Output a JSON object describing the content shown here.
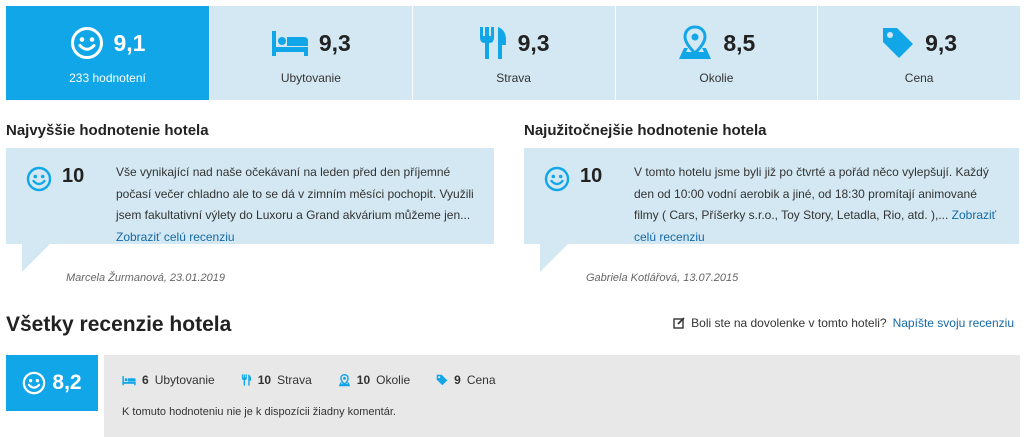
{
  "ratings": {
    "overall": {
      "score": "9,1",
      "label": "233 hodnotení",
      "icon": "smiley-icon"
    },
    "categories": [
      {
        "score": "9,3",
        "label": "Ubytovanie",
        "icon": "bed-icon"
      },
      {
        "score": "9,3",
        "label": "Strava",
        "icon": "fork-knife-icon"
      },
      {
        "score": "8,5",
        "label": "Okolie",
        "icon": "map-pin-icon"
      },
      {
        "score": "9,3",
        "label": "Cena",
        "icon": "price-tag-icon"
      }
    ]
  },
  "featured": {
    "best": {
      "title": "Najvyššie hodnotenie hotela",
      "score": "10",
      "text": "Vše vynikající nad naše očekávaní na leden před den příjemné počasí večer chladno ale to se dá v zimním měsíci pochopit. Využili jsem fakultativní výlety do Luxoru a Grand akvárium můžeme jen...",
      "more_link": "Zobraziť celú recenziu",
      "author": "Marcela Žurmanová, 23.01.2019"
    },
    "useful": {
      "title": "Najužitočnejšie hodnotenie hotela",
      "score": "10",
      "text": "V tomto hotelu jsme byli již po čtvrté a pořád něco vylepšují. Každý den od 10:00 vodní aerobik a jiné, od 18:30 promítají animované filmy ( Cars, Příšerky s.r.o., Toy Story, Letadla, Rio, atd. ),...",
      "more_link": "Zobraziť celú recenziu",
      "author": "Gabriela Kotlářová, 13.07.2015"
    }
  },
  "all_reviews": {
    "title": "Všetky recenzie hotela",
    "prompt": "Boli ste na dovolenke v tomto hoteli?",
    "write_link": "Napíšte svoju recenziu"
  },
  "review": {
    "score": "8,2",
    "subratings": [
      {
        "value": "6",
        "label": "Ubytovanie",
        "icon": "bed-icon"
      },
      {
        "value": "10",
        "label": "Strava",
        "icon": "fork-knife-icon"
      },
      {
        "value": "10",
        "label": "Okolie",
        "icon": "map-pin-icon"
      },
      {
        "value": "9",
        "label": "Cena",
        "icon": "price-tag-icon"
      }
    ],
    "comment": "K tomuto hodnoteniu nie je k dispozícii žiadny komentár."
  },
  "colors": {
    "accent": "#11a6e8",
    "panel": "#d3e8f2",
    "link": "#1469a6",
    "row_bg": "#e8e8e8"
  }
}
